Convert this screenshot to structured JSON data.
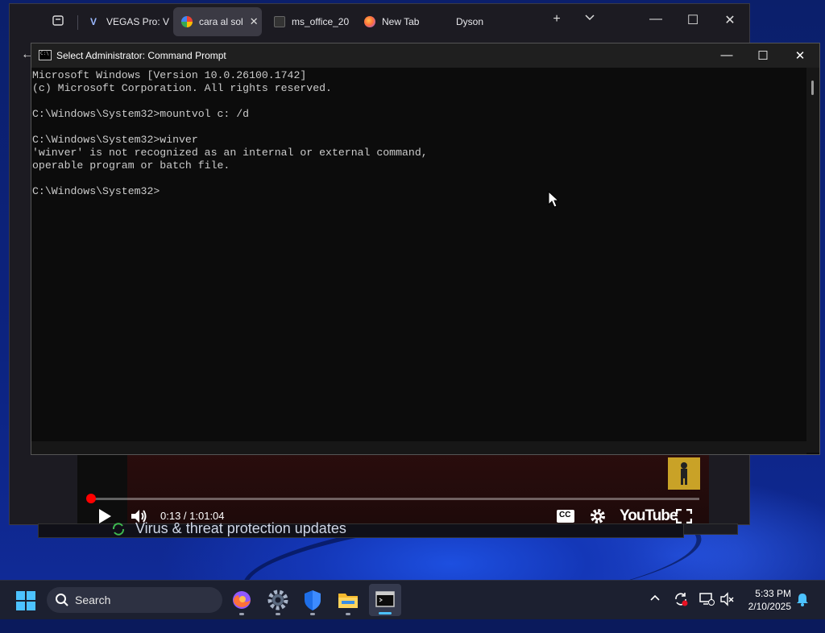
{
  "browser": {
    "tabs": [
      {
        "label": "VEGAS Pro: V",
        "icon": "vegas-icon"
      },
      {
        "label": "cara al sol",
        "icon": "google-icon",
        "active": true
      },
      {
        "label": "ms_office_20",
        "icon": "page-icon"
      },
      {
        "label": "New Tab",
        "icon": "firefox-icon"
      },
      {
        "label": "Dyson",
        "icon": ""
      }
    ],
    "new_tab": "+",
    "tab_list": "⌵",
    "minimize": "—",
    "maximize": "☐",
    "close": "✕"
  },
  "cmd": {
    "title": "Select Administrator: Command Prompt",
    "lines": [
      "Microsoft Windows [Version 10.0.26100.1742]",
      "(c) Microsoft Corporation. All rights reserved.",
      "",
      "C:\\Windows\\System32>mountvol c: /d",
      "",
      "C:\\Windows\\System32>winver",
      "'winver' is not recognized as an internal or external command,",
      "operable program or batch file.",
      "",
      "C:\\Windows\\System32>"
    ]
  },
  "video": {
    "time": "0:13 / 1:01:04",
    "progress": 0.003,
    "logo": "YouTube",
    "cc": "CC"
  },
  "toast": {
    "text": "Virus & threat protection updates"
  },
  "taskbar": {
    "search_label": "Search",
    "time": "5:33 PM",
    "date": "2/10/2025"
  },
  "colors": {
    "accent": "#4cc2ff",
    "progress": "#ff0000",
    "console_text": "#cccccc"
  }
}
